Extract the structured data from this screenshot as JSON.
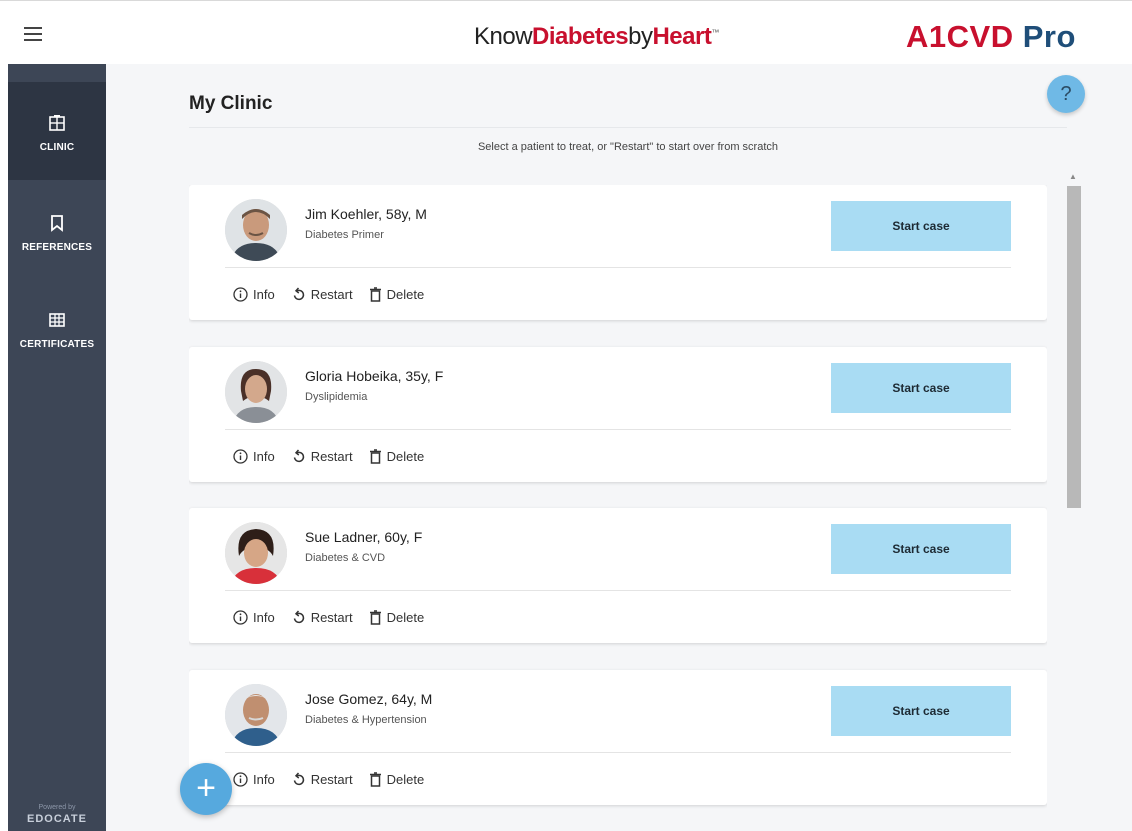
{
  "header": {
    "brand_know": "Know",
    "brand_diabetes": "Diabetes",
    "brand_by": "by",
    "brand_heart": "Heart",
    "brand_tm": "™",
    "product_a1cvd": "A1CVD",
    "product_pro": "Pro",
    "menu_icon": "hamburger-icon"
  },
  "sidebar": {
    "items": [
      {
        "label": "CLINIC",
        "icon": "clinic-icon",
        "active": true
      },
      {
        "label": "REFERENCES",
        "icon": "bookmark-icon",
        "active": false
      },
      {
        "label": "CERTIFICATES",
        "icon": "certificate-icon",
        "active": false
      }
    ],
    "powered_by": "Powered by",
    "powered_brand": "EDOCATE"
  },
  "main": {
    "title": "My Clinic",
    "help_label": "?",
    "subtitle": "Select a patient to treat, or \"Restart\" to start over from scratch"
  },
  "patients": [
    {
      "name": "Jim Koehler, 58y, M",
      "topic": "Diabetes Primer",
      "start_label": "Start case",
      "info_label": "Info",
      "restart_label": "Restart",
      "delete_label": "Delete"
    },
    {
      "name": "Gloria Hobeika, 35y, F",
      "topic": "Dyslipidemia",
      "start_label": "Start case",
      "info_label": "Info",
      "restart_label": "Restart",
      "delete_label": "Delete"
    },
    {
      "name": "Sue Ladner, 60y, F",
      "topic": "Diabetes & CVD",
      "start_label": "Start case",
      "info_label": "Info",
      "restart_label": "Restart",
      "delete_label": "Delete"
    },
    {
      "name": "Jose Gomez, 64y, M",
      "topic": "Diabetes & Hypertension",
      "start_label": "Start case",
      "info_label": "Info",
      "restart_label": "Restart",
      "delete_label": "Delete"
    }
  ],
  "fab": {
    "label": "+"
  },
  "colors": {
    "accent": "#a9dcf3",
    "fab": "#56a9de",
    "sidebar": "#3d4656",
    "brand_red": "#c8102e",
    "brand_blue": "#1f4e79"
  }
}
